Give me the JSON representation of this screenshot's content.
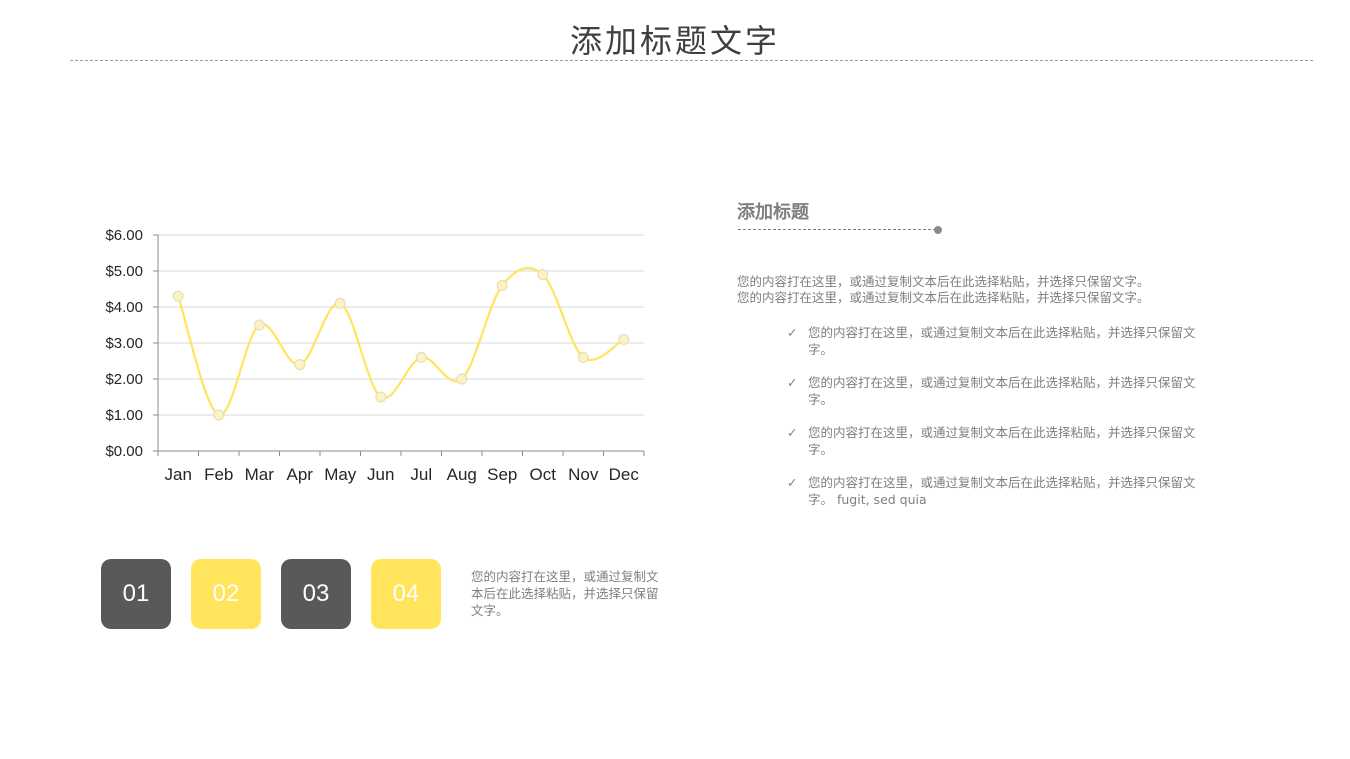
{
  "page": {
    "title": "添加标题文字"
  },
  "chart_data": {
    "type": "line",
    "smooth": true,
    "categories": [
      "Jan",
      "Feb",
      "Mar",
      "Apr",
      "May",
      "Jun",
      "Jul",
      "Aug",
      "Sep",
      "Oct",
      "Nov",
      "Dec"
    ],
    "series": [
      {
        "values": [
          4.3,
          1.0,
          3.5,
          2.4,
          4.1,
          1.5,
          2.6,
          2.0,
          4.6,
          4.9,
          2.6,
          3.1
        ],
        "color": "#ffe45c"
      }
    ],
    "ylim": [
      0,
      6
    ],
    "yticks": [
      "$0.00",
      "$1.00",
      "$2.00",
      "$3.00",
      "$4.00",
      "$5.00",
      "$6.00"
    ],
    "grid": true,
    "legend": "none"
  },
  "badges": [
    {
      "label": "01",
      "color": "#595959"
    },
    {
      "label": "02",
      "color": "#ffe45c"
    },
    {
      "label": "03",
      "color": "#595959"
    },
    {
      "label": "04",
      "color": "#ffe45c"
    }
  ],
  "badge_text": "您的内容打在这里，或通过复制文本后在此选择粘贴，并选择只保留文字。",
  "section": {
    "title": "添加标题",
    "intro": [
      "您的内容打在这里，或通过复制文本后在此选择粘贴，并选择只保留文字。",
      "您的内容打在这里，或通过复制文本后在此选择粘贴，并选择只保留文字。"
    ],
    "check_icon": "✓",
    "bullets": [
      "您的内容打在这里，或通过复制文本后在此选择粘贴，并选择只保留文字。",
      "您的内容打在这里，或通过复制文本后在此选择粘贴，并选择只保留文字。",
      "您的内容打在这里，或通过复制文本后在此选择粘贴，并选择只保留文字。",
      "您的内容打在这里，或通过复制文本后在此选择粘贴，并选择只保留文字。 fugit, sed quia"
    ]
  }
}
